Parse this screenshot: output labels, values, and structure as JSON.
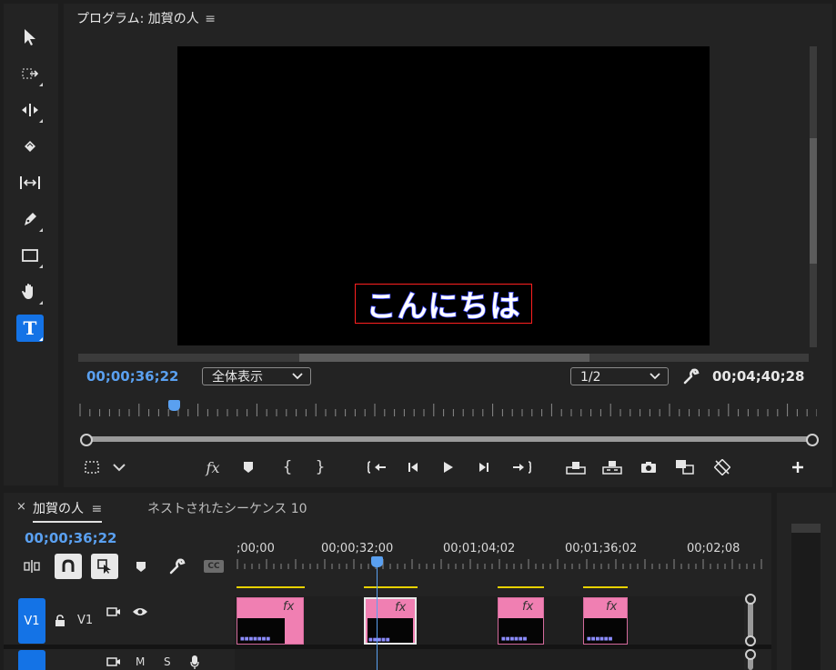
{
  "program_monitor": {
    "title": "プログラム: 加賀の人",
    "menu_icon": "≡",
    "caption_text": "こんにちは",
    "current_timecode": "00;00;36;22",
    "fit_dropdown": "全体表示",
    "resolution_dropdown": "1/2",
    "duration_timecode": "00;04;40;28"
  },
  "tools": [
    {
      "name": "selection-tool-icon"
    },
    {
      "name": "track-select-forward-tool-icon"
    },
    {
      "name": "ripple-edit-tool-icon"
    },
    {
      "name": "razor-tool-icon"
    },
    {
      "name": "slip-tool-icon"
    },
    {
      "name": "pen-tool-icon"
    },
    {
      "name": "rectangle-tool-icon"
    },
    {
      "name": "hand-tool-icon"
    },
    {
      "name": "type-tool-icon",
      "selected": true
    }
  ],
  "transport": [
    "safe-margins-icon",
    "settings-chevron-icon",
    "fx-icon",
    "add-marker-icon",
    "mark-in-icon",
    "mark-out-icon",
    "go-to-in-icon",
    "step-back-icon",
    "play-icon",
    "step-forward-icon",
    "go-to-out-icon",
    "lift-icon",
    "extract-icon",
    "export-frame-icon",
    "comparison-view-icon",
    "proxy-toggle-icon",
    "add-button-icon"
  ],
  "timeline": {
    "tab_active": "加賀の人",
    "tab_inactive": "ネストされたシーケンス 10",
    "close_icon": "×",
    "menu_icon": "≡",
    "current_timecode": "00;00;36;22",
    "ruler_labels": [
      ";00;00",
      "00;00;32;00",
      "00;01;04;02",
      "00;01;36;02",
      "00;02;08"
    ],
    "tracks": [
      {
        "target_label": "V1",
        "name": "V1"
      },
      {
        "target_label": "",
        "name": "",
        "m": "M",
        "s": "S"
      }
    ],
    "cc_label": "CC"
  },
  "colors": {
    "accent": "#1473e6",
    "timecode_blue": "#5aa0f0",
    "clip_pink": "#f07fb2",
    "caption_stroke": "#3a46ff",
    "selection_red": "#ff2020"
  }
}
